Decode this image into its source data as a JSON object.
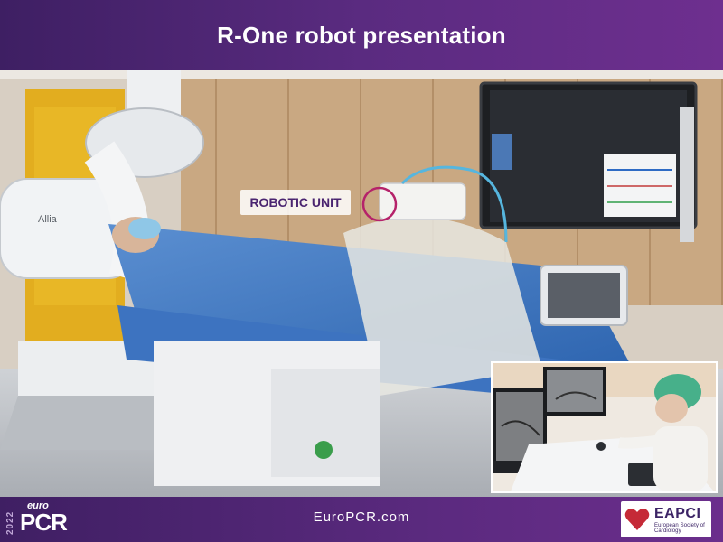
{
  "header": {
    "title": "R-One robot presentation"
  },
  "annotation": {
    "robotic_unit_label": "ROBOTIC UNIT"
  },
  "photo": {
    "main_description": "Catheterization lab scene (visual only)",
    "device_wordmark": "Allia"
  },
  "footer": {
    "logo_year": "2022",
    "logo_top": "euro",
    "logo_main": "PCR",
    "url": "EuroPCR.com",
    "eapci_title": "EAPCI",
    "eapci_subtitle": "European Society of Cardiology"
  },
  "colors": {
    "header_purple": "#5a2b80",
    "label_text": "#4a2470",
    "highlight_circle": "#b5226a"
  }
}
